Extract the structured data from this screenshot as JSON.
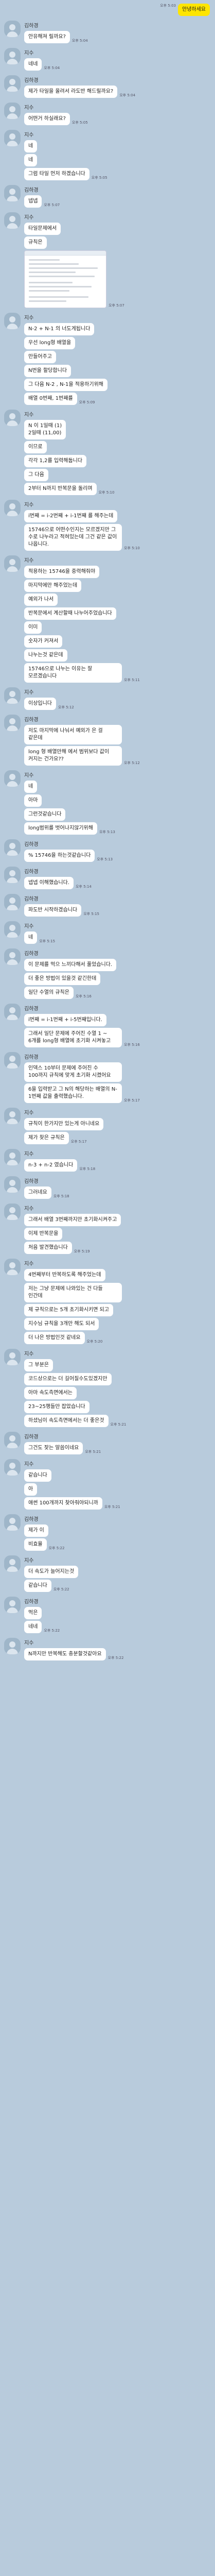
{
  "messages": [
    {
      "side": "me",
      "text": "안녕하세요",
      "time": "오후 5:03"
    },
    {
      "side": "them",
      "sender": "김하경",
      "text": "안유해져 릴까요?",
      "time": "오후 5:04"
    },
    {
      "side": "them",
      "sender": "지수",
      "text": "네네",
      "time": "오후 5:04"
    },
    {
      "side": "them",
      "sender": "김하경",
      "text": "제가 타일을 올려서 라도반 해드릴까요?",
      "time": "오후 5:04"
    },
    {
      "side": "them",
      "sender": "지수",
      "text": "어떤거 하실래요?",
      "time": "오후 5:05"
    },
    {
      "side": "them",
      "sender": "지수",
      "text": "네",
      "time": ""
    },
    {
      "side": "them",
      "text": "네",
      "time": ""
    },
    {
      "side": "them",
      "text": "그럼 타일 먼저 하겠습니다",
      "time": "오후 5:05"
    },
    {
      "side": "them",
      "sender": "김하경",
      "text": "넵넵",
      "time": "오후 5:07"
    },
    {
      "side": "them",
      "sender": "지수",
      "text": "타일문제에서",
      "time": ""
    },
    {
      "side": "them",
      "text": "규칙은",
      "time": ""
    },
    {
      "side": "them",
      "type": "image",
      "time": "오후 5:07"
    },
    {
      "side": "them",
      "sender": "지수",
      "text": "N-2 + N-1 의 너도게됩니다",
      "time": ""
    },
    {
      "side": "them",
      "text": "우선 long형 배열을",
      "time": ""
    },
    {
      "side": "them",
      "text": "만들어주고",
      "time": ""
    },
    {
      "side": "them",
      "text": "N번을 할당합니다",
      "time": ""
    },
    {
      "side": "them",
      "text": "그 다음 N-2 , N-1을 적용하기위해",
      "time": ""
    },
    {
      "side": "them",
      "text": "배열 0번째, 1번째를",
      "time": "오후 5:09"
    },
    {
      "side": "them",
      "sender": "지수",
      "text": "N 이 1일때 (1)\n2일때 (11,00)",
      "time": ""
    },
    {
      "side": "them",
      "text": "이므로",
      "time": ""
    },
    {
      "side": "them",
      "text": "각각 1,2를 입력해둡니다",
      "time": ""
    },
    {
      "side": "them",
      "text": "그 다음",
      "time": ""
    },
    {
      "side": "them",
      "text": "2부터 N까지 반복문을 돌리며",
      "time": "오후 5:10"
    },
    {
      "side": "them",
      "sender": "지수",
      "text": "i번째 = i-2번째 + i-1번째 를 해주는데",
      "time": ""
    },
    {
      "side": "them",
      "text": "15746으로 어떤수인지는 모르겠지만 그 수로 나누라고 적혀있는데 그건 같은 값이 나옵니다.",
      "time": "오후 5:10"
    },
    {
      "side": "them",
      "sender": "지수",
      "text": "적용하는 15746을 중력해줘야",
      "time": ""
    },
    {
      "side": "them",
      "text": "마지막에만 해주었는데",
      "time": ""
    },
    {
      "side": "them",
      "text": "예외가 나서",
      "time": ""
    },
    {
      "side": "them",
      "text": "반복문에서 계산할때 나누어주었습니다",
      "time": ""
    },
    {
      "side": "them",
      "text": "이미",
      "time": ""
    },
    {
      "side": "them",
      "text": "숫자가 커져서",
      "time": ""
    },
    {
      "side": "them",
      "text": "나누는것 같은데",
      "time": ""
    },
    {
      "side": "them",
      "text": "15746으로 나누는 이유는 잘 모르겠습니다",
      "time": "오후 5:11"
    },
    {
      "side": "them",
      "sender": "지수",
      "text": "이상입니다",
      "time": "오후 5:12"
    },
    {
      "side": "them",
      "sender": "김하경",
      "text": "저도 마지막에 나눠서 예외가 은 걸 같은데",
      "time": ""
    },
    {
      "side": "them",
      "text": "long 형 배열만해 에서 범위보다 값이 커지는 건가요??",
      "time": "오후 5:12"
    },
    {
      "side": "them",
      "sender": "지수",
      "text": "네",
      "time": ""
    },
    {
      "side": "them",
      "text": "아마",
      "time": ""
    },
    {
      "side": "them",
      "text": "그런것같습니다",
      "time": ""
    },
    {
      "side": "them",
      "text": "long범위를 벗어나지않기위해",
      "time": "오후 5:13"
    },
    {
      "side": "them",
      "sender": "김하경",
      "text": "% 15746을 하는것같습니다",
      "time": "오후 5:13"
    },
    {
      "side": "them",
      "sender": "김하경",
      "text": "넵넵 이해했습니다.",
      "time": "오후 5:14"
    },
    {
      "side": "them",
      "sender": "김하경",
      "text": "파도반 시작하겠습니다",
      "time": "오후 5:15"
    },
    {
      "side": "them",
      "sender": "지수",
      "text": "네",
      "time": "오후 5:15"
    },
    {
      "side": "them",
      "sender": "김하경",
      "text": "이 문제를 먹으 느끼다해서 풀었습니다.",
      "time": ""
    },
    {
      "side": "them",
      "text": "더 좋은 방법이 있을것 같긴한데",
      "time": ""
    },
    {
      "side": "them",
      "text": "일단 수열의 규칙은",
      "time": "오후 5:16"
    },
    {
      "side": "them",
      "sender": "김하경",
      "text": "i번째 = i-1번째 + i-5번째입니다.",
      "time": ""
    },
    {
      "side": "them",
      "text": "그래서 일단 문제에 주어진 수열 1 ~ 6개를 long형 배열에 초기화 시켜놓고",
      "time": "오후 5:16"
    },
    {
      "side": "them",
      "sender": "김하경",
      "text": "인덱스 10부터 문제에 주어진 수 100까지 규칙에 맞게 초기화 시켰어요",
      "time": ""
    },
    {
      "side": "them",
      "text": "6을 입력받고 그 N의 해당하는 배열의 N-1번째 값을 출력했습니다.",
      "time": "오후 5:17"
    },
    {
      "side": "them",
      "sender": "지수",
      "text": "규칙이 한가지만 있는게 아니네요",
      "time": ""
    },
    {
      "side": "them",
      "text": "제가 찾은 규칙은",
      "time": "오후 5:17"
    },
    {
      "side": "them",
      "sender": "지수",
      "text": "n-3 + n-2 였습니다",
      "time": "오후 5:18"
    },
    {
      "side": "them",
      "sender": "김하경",
      "text": "그러네요",
      "time": "오후 5:18"
    },
    {
      "side": "them",
      "sender": "지수",
      "text": "그래서 배열 3번째까지만 초기화시켜주고",
      "time": ""
    },
    {
      "side": "them",
      "text": "이제 반복문을",
      "time": ""
    },
    {
      "side": "them",
      "text": "처음 발견했습니다",
      "time": "오후 5:19"
    },
    {
      "side": "them",
      "sender": "지수",
      "text": "4번째부터 반복하도록 해주었는데",
      "time": ""
    },
    {
      "side": "them",
      "text": "저는 그냥 문제에 나와있는 건 다들 인간데",
      "time": ""
    },
    {
      "side": "them",
      "text": "제 규칙으로는 5개 초기화시키면 되고",
      "time": ""
    },
    {
      "side": "them",
      "text": "지수님 규칙을 3개만 해도 되서",
      "time": ""
    },
    {
      "side": "them",
      "text": "더 나은 방법인것 같네요",
      "time": "오후 5:20"
    },
    {
      "side": "them",
      "sender": "지수",
      "text": "그 부분은",
      "time": ""
    },
    {
      "side": "them",
      "text": "코드상으로는 더 길어질수도있겠지만",
      "time": ""
    },
    {
      "side": "them",
      "text": "아마 속도측면에서는",
      "time": ""
    },
    {
      "side": "them",
      "text": "23~25행들만 잡았습니다",
      "time": ""
    },
    {
      "side": "them",
      "text": "하셨님이 속도측면에서는 더 좋은것",
      "time": "오후 5:21"
    },
    {
      "side": "them",
      "sender": "김하경",
      "text": "그건도 잦는 말씀이네요",
      "time": "오후 5:21"
    },
    {
      "side": "them",
      "sender": "지수",
      "text": "같습니다",
      "time": ""
    },
    {
      "side": "them",
      "text": "아",
      "time": ""
    },
    {
      "side": "them",
      "text": "애썬 100개까지 찾아줘야되니까",
      "time": "오후 5:21"
    },
    {
      "side": "them",
      "sender": "김하경",
      "text": "제가 이",
      "time": ""
    },
    {
      "side": "them",
      "text": "비효율",
      "time": "오후 5:22"
    },
    {
      "side": "them",
      "sender": "지수",
      "text": "더 속도가 늘어지는것",
      "time": ""
    },
    {
      "side": "them",
      "text": "같습니다",
      "time": "오후 5:22"
    },
    {
      "side": "them",
      "sender": "김하경",
      "text": "먹은",
      "time": ""
    },
    {
      "side": "them",
      "text": "네네",
      "time": "오후 5:22"
    },
    {
      "side": "them",
      "sender": "지수",
      "text": "N까지만 반복해도 충분할것같아요",
      "time": "오후 5:22"
    }
  ]
}
